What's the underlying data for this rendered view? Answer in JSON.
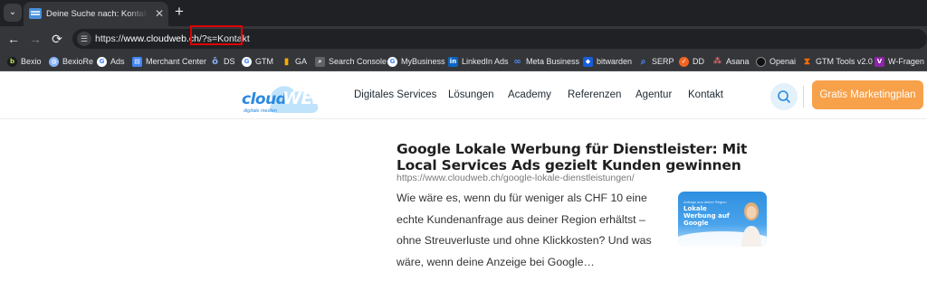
{
  "browser": {
    "tab": {
      "title": "Deine Suche nach: Kontakt • cloudWEB"
    },
    "address": {
      "scheme": "https://",
      "host": "www.cloudweb.ch",
      "path": "/",
      "query": "?s=Kontakt"
    },
    "bookmarks": [
      {
        "label": "Bexio",
        "icon": "bexio-icon",
        "color": "#1c1c1c"
      },
      {
        "label": "BexioRe",
        "icon": "globe-icon",
        "color": "#8ab4f8"
      },
      {
        "label": "Ads",
        "icon": "google-icon",
        "color": "#ffffff"
      },
      {
        "label": "Merchant Center",
        "icon": "merchant-center-icon",
        "color": "#4285f4"
      },
      {
        "label": "DS",
        "icon": "looker-studio-icon",
        "color": "#669df6"
      },
      {
        "label": "GTM",
        "icon": "google-icon",
        "color": "#ffffff"
      },
      {
        "label": "GA",
        "icon": "analytics-icon",
        "color": "#f9ab00"
      },
      {
        "label": "Search Console",
        "icon": "search-console-icon",
        "color": "#5f6368"
      },
      {
        "label": "MyBusiness",
        "icon": "google-icon",
        "color": "#ffffff"
      },
      {
        "label": "LinkedIn Ads",
        "icon": "linkedin-icon",
        "color": "#0a66c2"
      },
      {
        "label": "Meta Business",
        "icon": "meta-icon",
        "color": "#0668e1"
      },
      {
        "label": "bitwarden",
        "icon": "bitwarden-icon",
        "color": "#175ddc"
      },
      {
        "label": "SERP",
        "icon": "serp-icon",
        "color": "#1a73e8"
      },
      {
        "label": "DD",
        "icon": "dd-icon",
        "color": "#f26522"
      },
      {
        "label": "Asana",
        "icon": "asana-icon",
        "color": "#f06a6a"
      },
      {
        "label": "Openai",
        "icon": "openai-icon",
        "color": "#111111"
      },
      {
        "label": "GTM Tools v2.0",
        "icon": "gtm-tools-icon",
        "color": "#ff6d00"
      },
      {
        "label": "W-Fragen",
        "icon": "w-fragen-icon",
        "color": "#8e24aa"
      }
    ]
  },
  "site": {
    "logo": {
      "text_cloud": "cloud",
      "text_web": "WEB",
      "tagline": "digitale medien"
    },
    "nav": [
      {
        "label": "Digitales Services"
      },
      {
        "label": "Lösungen"
      },
      {
        "label": "Academy"
      },
      {
        "label": "Referenzen"
      },
      {
        "label": "Agentur"
      },
      {
        "label": "Kontakt"
      }
    ],
    "cta_label": "Gratis Marketingplan"
  },
  "result": {
    "title": "Google Lokale Werbung für Dienstleister: Mit Local Services Ads gezielt Kunden gewinnen",
    "url": "https://www.cloudweb.ch/google-lokale-dienstleistungen/",
    "excerpt": "Wie wäre es, wenn du für weniger als CHF 10 eine echte Kundenanfrage aus deiner Region erhältst – ohne Streuverluste und ohne Klickkosten? Und was wäre, wenn deine Anzeige bei Google…",
    "thumbnail": {
      "small_text": "Anfrage aus deiner Region",
      "title": "Lokale Werbung auf Google"
    }
  },
  "colors": {
    "cta": "#f7a14a",
    "highlight": "#e00000",
    "logo_blue": "#2a8ae0"
  }
}
